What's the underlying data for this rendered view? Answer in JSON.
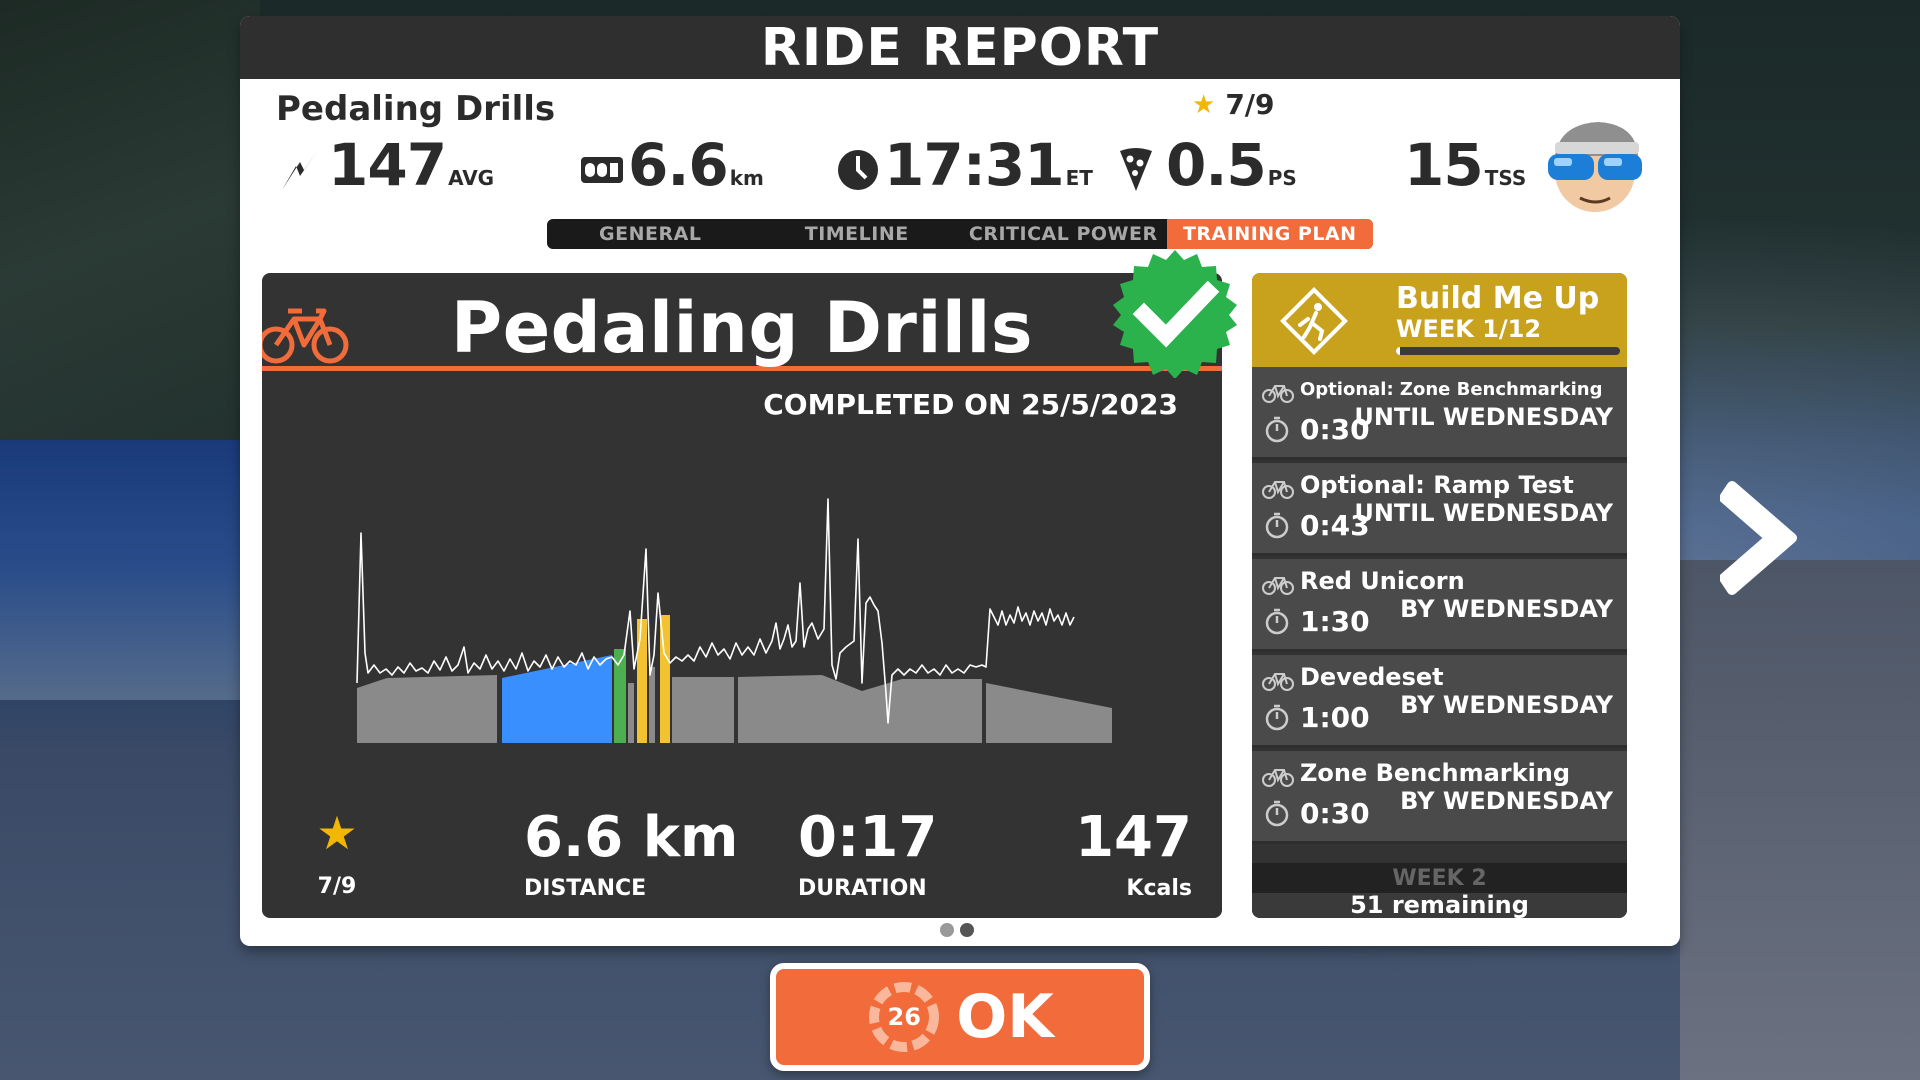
{
  "report": {
    "title": "RIDE REPORT",
    "ride_name": "Pedaling Drills",
    "rating": "7/9",
    "stats": {
      "power": {
        "value": "147",
        "unit": "AVG",
        "icon": "power-lightning-icon"
      },
      "distance": {
        "value": "6.6",
        "unit": "km",
        "icon": "odometer-icon"
      },
      "time": {
        "value": "17:31",
        "unit": "ET",
        "icon": "clock-icon"
      },
      "pizza": {
        "value": "0.5",
        "unit": "PS",
        "icon": "pizza-slice-icon"
      },
      "tss": {
        "value": "15",
        "unit": "TSS"
      }
    },
    "tabs": [
      {
        "label": "GENERAL",
        "active": false
      },
      {
        "label": "TIMELINE",
        "active": false
      },
      {
        "label": "CRITICAL POWER",
        "active": false
      },
      {
        "label": "TRAINING PLAN",
        "active": true
      }
    ]
  },
  "workout_card": {
    "title": "Pedaling Drills",
    "completed": "COMPLETED ON 25/5/2023",
    "rating": "7/9",
    "distance": {
      "value": "6.6 km",
      "label": "DISTANCE"
    },
    "duration": {
      "value": "0:17",
      "label": "DURATION"
    },
    "calories": {
      "value": "147",
      "label": "Kcals"
    }
  },
  "plan": {
    "title": "Build Me Up",
    "week": "WEEK 1/12",
    "progress": 0.02,
    "workouts": [
      {
        "name": "Optional: Zone Benchmarking",
        "duration": "0:30",
        "when": "UNTIL WEDNESDAY"
      },
      {
        "name": "Optional: Ramp Test",
        "duration": "0:43",
        "when": "UNTIL WEDNESDAY"
      },
      {
        "name": "Red Unicorn",
        "duration": "1:30",
        "when": "BY WEDNESDAY"
      },
      {
        "name": "Devedeset",
        "duration": "1:00",
        "when": "BY WEDNESDAY"
      },
      {
        "name": "Zone Benchmarking",
        "duration": "0:30",
        "when": "BY WEDNESDAY"
      }
    ],
    "next_week": "WEEK 2",
    "remaining": "51 remaining"
  },
  "ok_button": {
    "countdown": "26",
    "label": "OK"
  },
  "colors": {
    "accent": "#f26b3a",
    "plan_gold": "#c9a21d",
    "zone_blue": "#3a8fff",
    "zone_green": "#4caf50",
    "zone_yellow": "#f2c230",
    "zone_grey": "#8a8a8a"
  }
}
